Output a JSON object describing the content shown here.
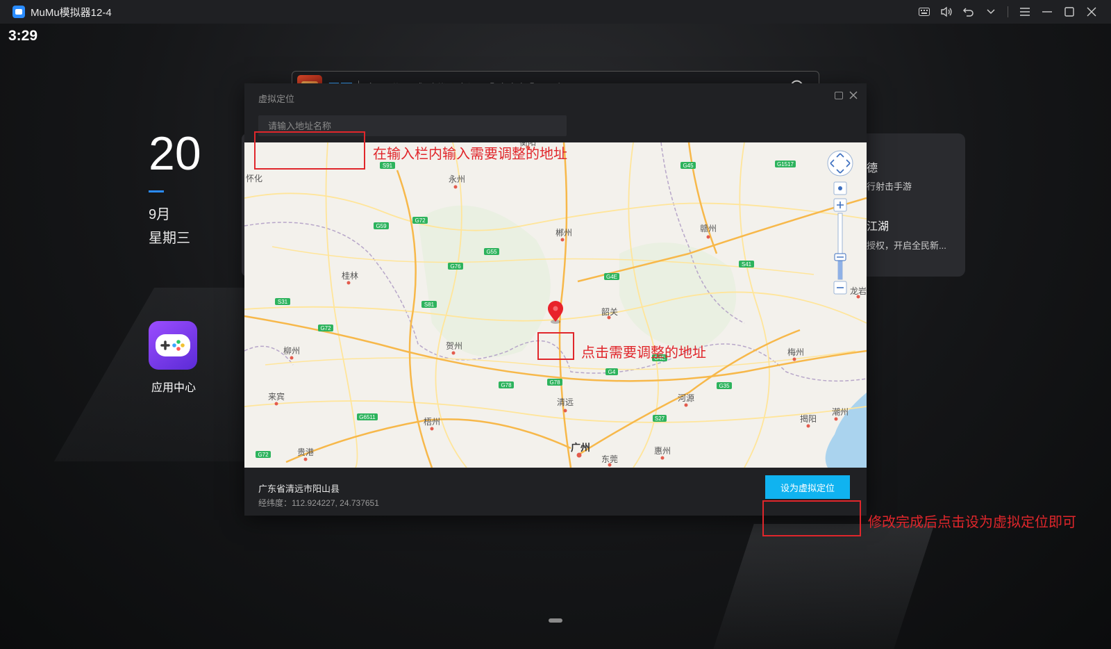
{
  "window": {
    "title": "MuMu模拟器12-4"
  },
  "status": {
    "time": "3:29"
  },
  "date": {
    "day": "20",
    "month": "9月",
    "weekday": "星期三"
  },
  "app_center": {
    "label": "应用中心"
  },
  "searchbar": {
    "game_name": "天下",
    "promo_text": "全面进入贰时代，新服【醉今朝】开启"
  },
  "right_card": {
    "item1_title": "德",
    "item1_sub": "行射击手游",
    "item2_title": "江湖",
    "item2_sub": "授权，开启全民新..."
  },
  "dialog": {
    "title": "虚拟定位",
    "input_placeholder": "请输入地址名称",
    "address": "广东省清远市阳山县",
    "coords": "经纬度：112.924227, 24.737651",
    "set_button": "设为虚拟定位"
  },
  "annotations": {
    "input_hint": "在输入栏内输入需要调整的地址",
    "click_hint": "点击需要调整的地址",
    "done_hint": "修改完成后点击设为虚拟定位即可"
  },
  "map": {
    "cities": [
      {
        "name": "衡阳"
      },
      {
        "name": "永州"
      },
      {
        "name": "郴州"
      },
      {
        "name": "桂林"
      },
      {
        "name": "韶关"
      },
      {
        "name": "赣州"
      },
      {
        "name": "贺州"
      },
      {
        "name": "柳州"
      },
      {
        "name": "梅州"
      },
      {
        "name": "来宾"
      },
      {
        "name": "清远"
      },
      {
        "name": "河源"
      },
      {
        "name": "梧州"
      },
      {
        "name": "揭阳"
      },
      {
        "name": "潮州"
      },
      {
        "name": "广州"
      },
      {
        "name": "贵港"
      },
      {
        "name": "东莞"
      },
      {
        "name": "惠州"
      },
      {
        "name": "龙岩"
      },
      {
        "name": "怀化"
      }
    ],
    "roads": [
      "S91",
      "G59",
      "G72",
      "G55",
      "G76",
      "G4E",
      "G45",
      "G1517",
      "S41",
      "S31",
      "S81",
      "G72",
      "G4E",
      "G78",
      "G4",
      "G35",
      "G6511",
      "S27",
      "G72",
      "G78"
    ]
  },
  "colors": {
    "accent": "#10b3f0",
    "annotation": "#e0262b",
    "brand": "#2a8cff"
  }
}
